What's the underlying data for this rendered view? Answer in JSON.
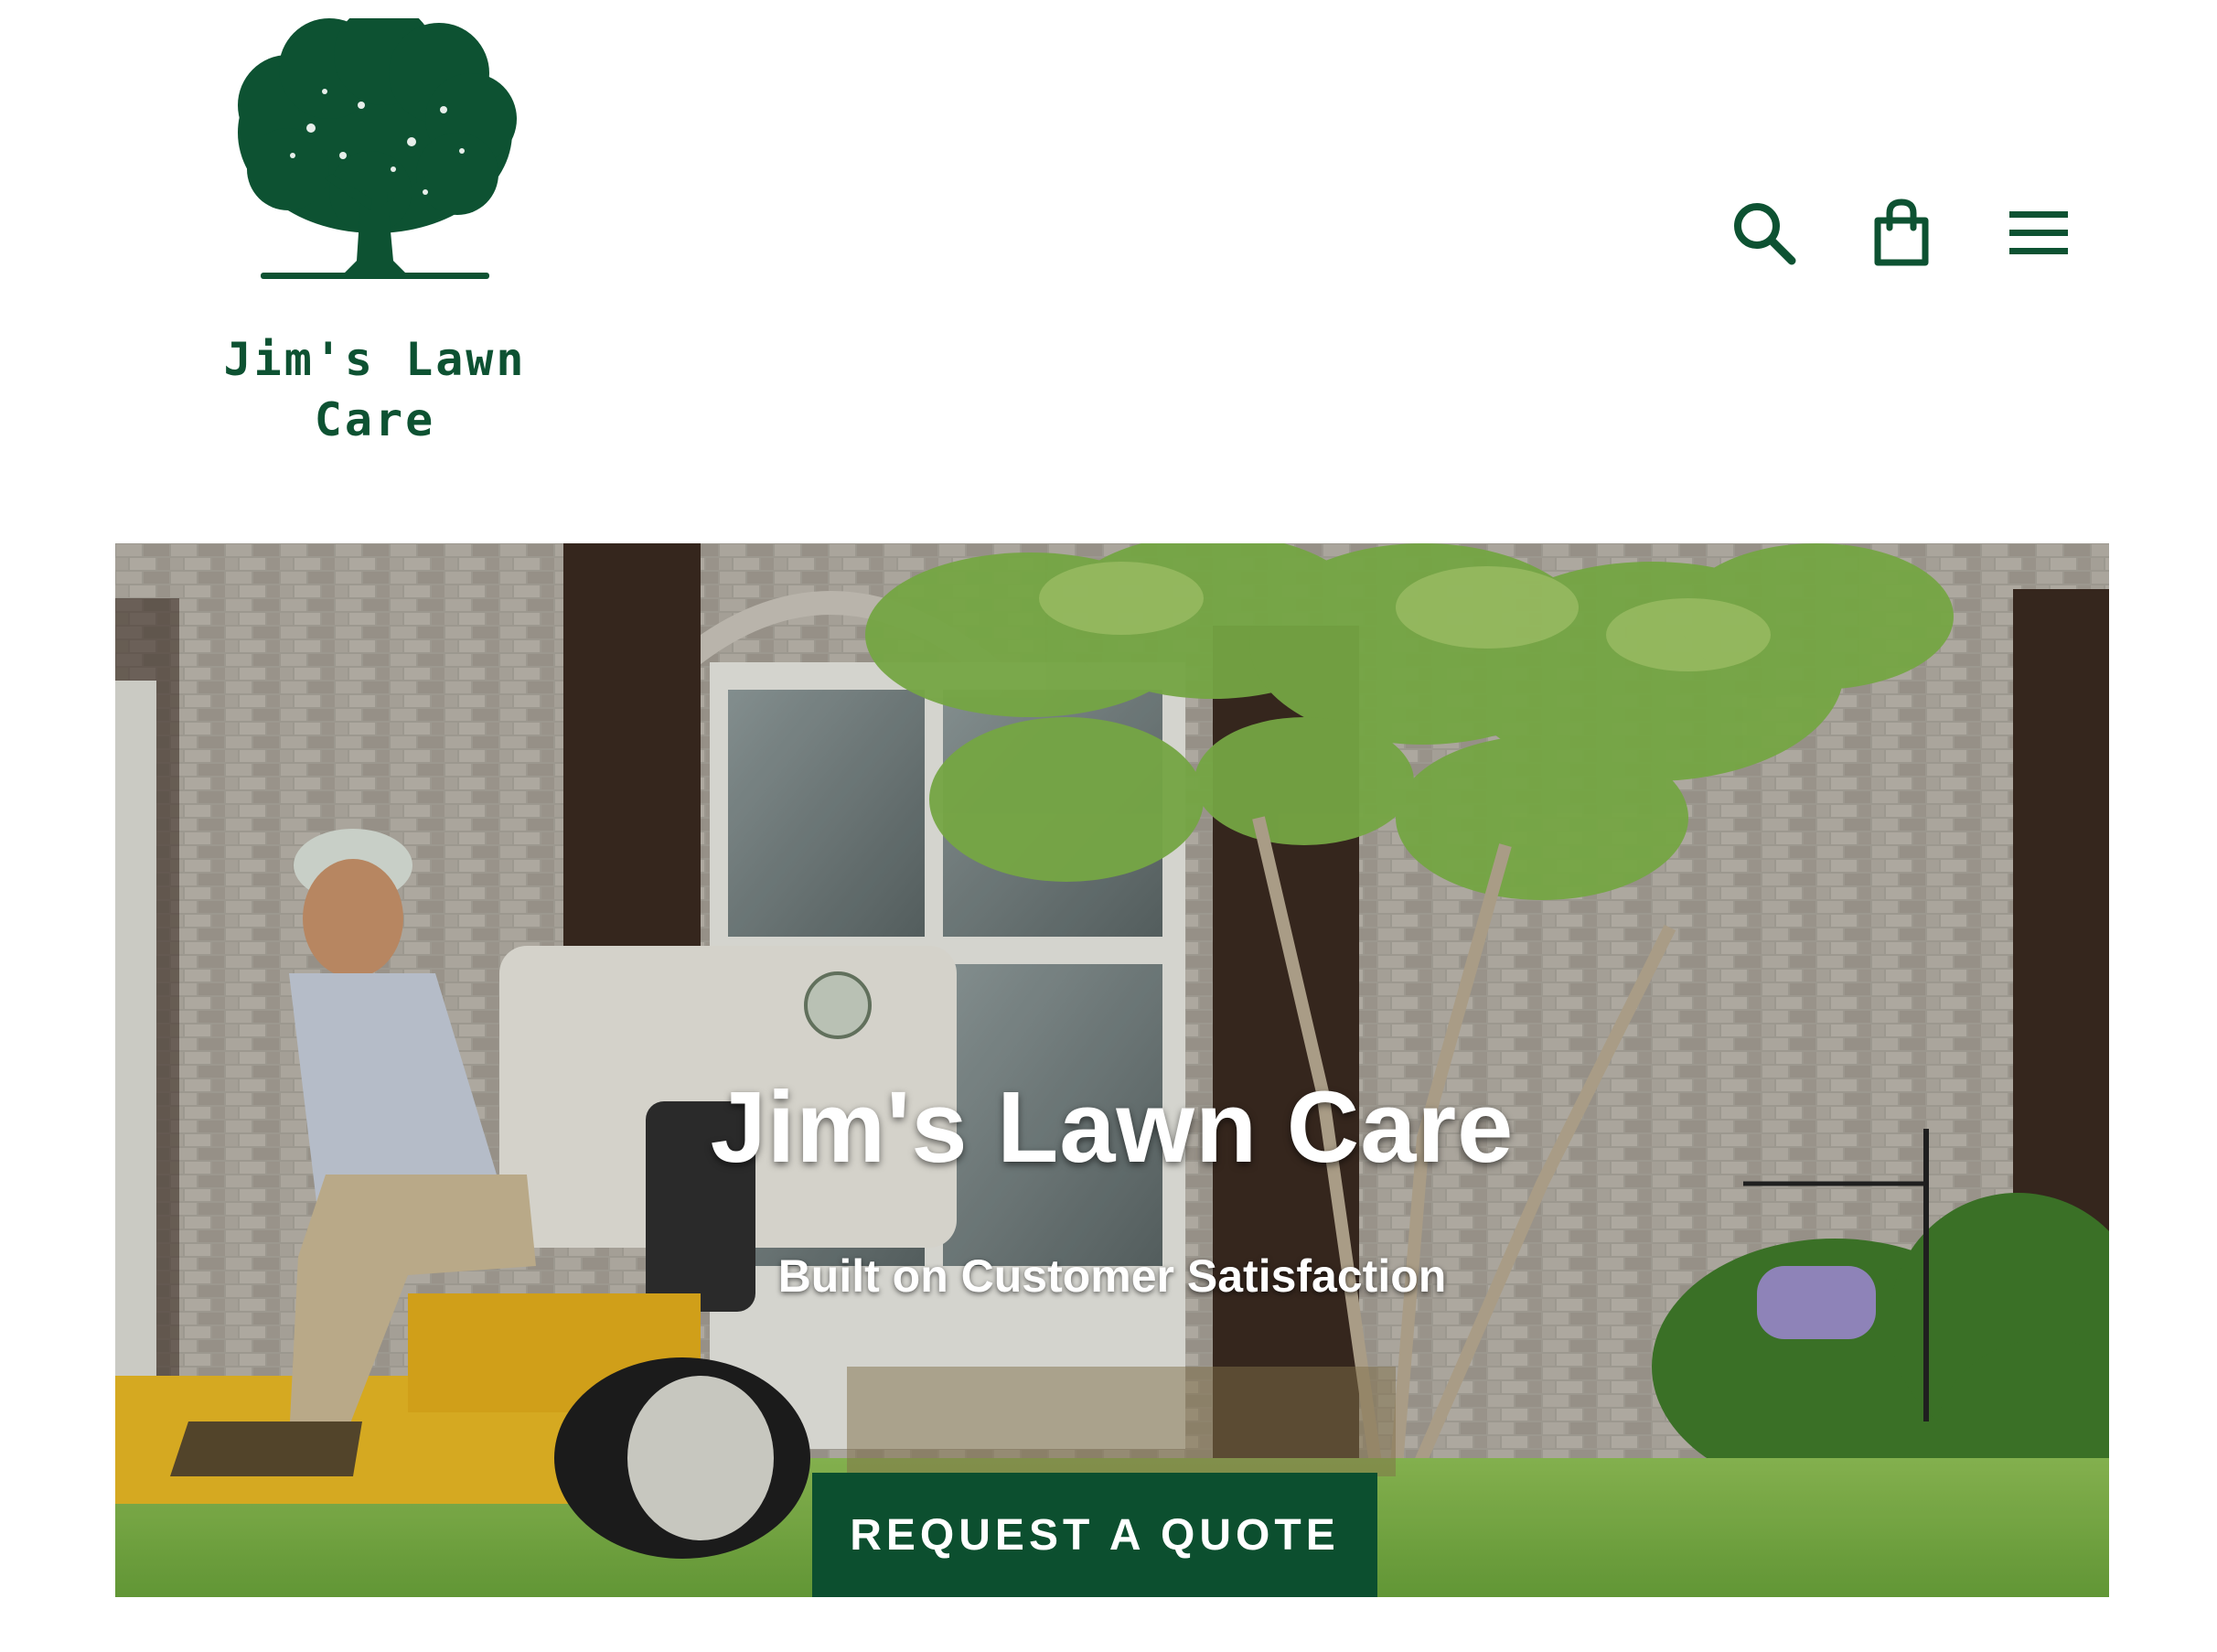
{
  "brand": {
    "logo_text": "Jim's Lawn\nCare",
    "logo_icon": "oak-tree-logo",
    "color": "#0d5232"
  },
  "header": {
    "icons": [
      {
        "name": "search-icon",
        "label": "Search"
      },
      {
        "name": "cart-bag-icon",
        "label": "Cart"
      },
      {
        "name": "hamburger-menu-icon",
        "label": "Menu"
      }
    ],
    "icon_color": "#0d5232"
  },
  "hero": {
    "title": "Jim's Lawn Care",
    "subtitle": "Built on Customer Satisfaction",
    "cta_label": "REQUEST A QUOTE",
    "cta_color": "#0c4f2f"
  }
}
